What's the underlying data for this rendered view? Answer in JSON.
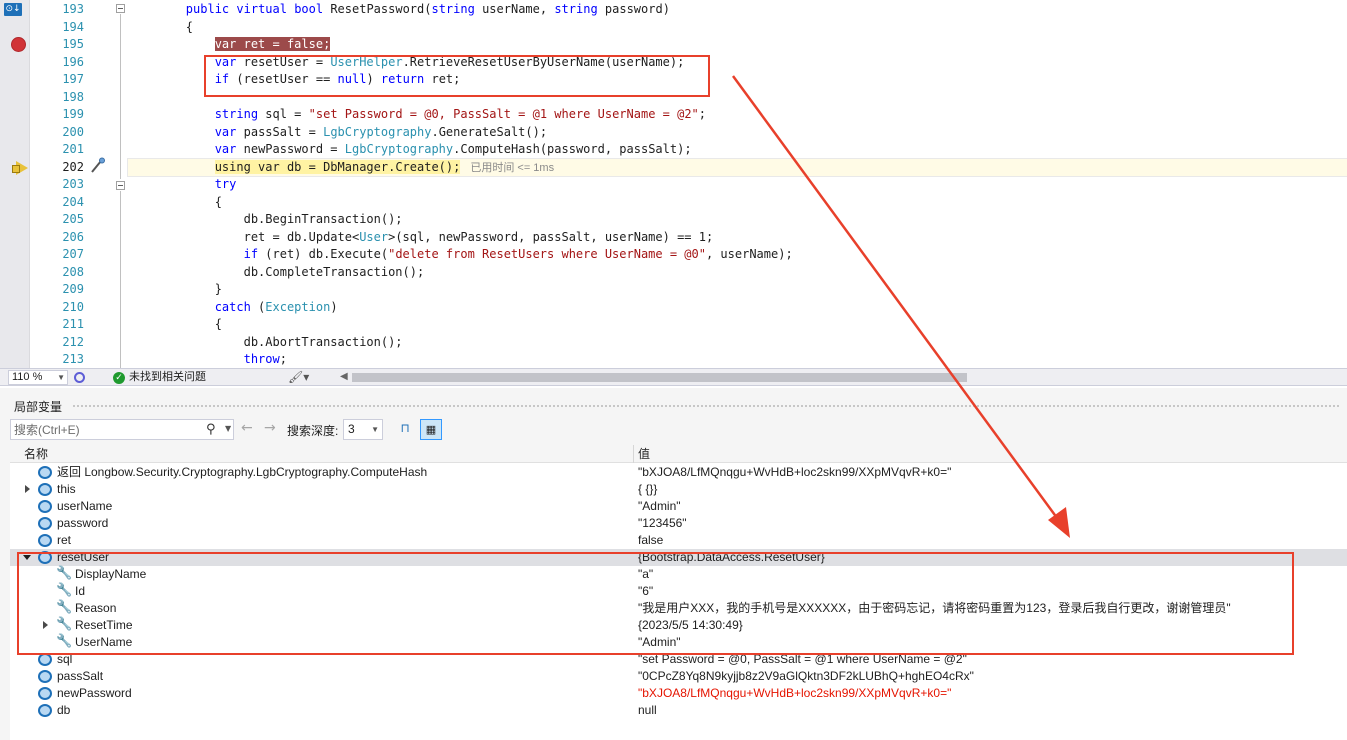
{
  "editor": {
    "line_numbers": [
      "193",
      "194",
      "195",
      "196",
      "197",
      "198",
      "199",
      "200",
      "201",
      "202",
      "203",
      "204",
      "205",
      "206",
      "207",
      "208",
      "209",
      "210",
      "211",
      "212",
      "213"
    ],
    "lines": [
      [
        [
          "pl",
          "        "
        ],
        [
          "kw",
          "public"
        ],
        [
          "pl",
          " "
        ],
        [
          "kw",
          "virtual"
        ],
        [
          "pl",
          " "
        ],
        [
          "kw",
          "bool"
        ],
        [
          "pl",
          " ResetPassword("
        ],
        [
          "kw",
          "string"
        ],
        [
          "pl",
          " userName, "
        ],
        [
          "kw",
          "string"
        ],
        [
          "pl",
          " password)"
        ]
      ],
      [
        [
          "pl",
          "        {"
        ]
      ],
      [
        [
          "pl",
          "            "
        ],
        [
          "bp",
          "var ret = false;"
        ]
      ],
      [
        [
          "pl",
          "            "
        ],
        [
          "kw",
          "var"
        ],
        [
          "pl",
          " resetUser = "
        ],
        [
          "ty",
          "UserHelper"
        ],
        [
          "pl",
          ".RetrieveResetUserByUserName(userName);"
        ]
      ],
      [
        [
          "pl",
          "            "
        ],
        [
          "kw",
          "if"
        ],
        [
          "pl",
          " (resetUser == "
        ],
        [
          "kw",
          "null"
        ],
        [
          "pl",
          ") "
        ],
        [
          "kw",
          "return"
        ],
        [
          "pl",
          " ret;"
        ]
      ],
      [
        [
          "pl",
          ""
        ]
      ],
      [
        [
          "pl",
          "            "
        ],
        [
          "kw",
          "string"
        ],
        [
          "pl",
          " sql = "
        ],
        [
          "str",
          "\"set Password = @0, PassSalt = @1 where UserName = @2\""
        ],
        [
          "pl",
          ";"
        ]
      ],
      [
        [
          "pl",
          "            "
        ],
        [
          "kw",
          "var"
        ],
        [
          "pl",
          " passSalt = "
        ],
        [
          "ty",
          "LgbCryptography"
        ],
        [
          "pl",
          ".GenerateSalt();"
        ]
      ],
      [
        [
          "pl",
          "            "
        ],
        [
          "kw",
          "var"
        ],
        [
          "pl",
          " newPassword = "
        ],
        [
          "ty",
          "LgbCryptography"
        ],
        [
          "pl",
          ".ComputeHash(password, passSalt);"
        ]
      ],
      [
        [
          "pl",
          "            "
        ],
        [
          "nx",
          "using var db = DbManager.Create();"
        ],
        [
          "perf",
          "已用时间 <= 1ms"
        ]
      ],
      [
        [
          "pl",
          "            "
        ],
        [
          "kw",
          "try"
        ]
      ],
      [
        [
          "pl",
          "            {"
        ]
      ],
      [
        [
          "pl",
          "                db.BeginTransaction();"
        ]
      ],
      [
        [
          "pl",
          "                ret = db.Update<"
        ],
        [
          "ty",
          "User"
        ],
        [
          "pl",
          ">(sql, newPassword, passSalt, userName) == 1;"
        ]
      ],
      [
        [
          "pl",
          "                "
        ],
        [
          "kw",
          "if"
        ],
        [
          "pl",
          " (ret) db.Execute("
        ],
        [
          "str",
          "\"delete from ResetUsers where UserName = @0\""
        ],
        [
          "pl",
          ", userName);"
        ]
      ],
      [
        [
          "pl",
          "                db.CompleteTransaction();"
        ]
      ],
      [
        [
          "pl",
          "            }"
        ]
      ],
      [
        [
          "pl",
          "            "
        ],
        [
          "kw",
          "catch"
        ],
        [
          "pl",
          " ("
        ],
        [
          "ty",
          "Exception"
        ],
        [
          "pl",
          ")"
        ]
      ],
      [
        [
          "pl",
          "            {"
        ]
      ],
      [
        [
          "pl",
          "                db.AbortTransaction();"
        ]
      ],
      [
        [
          "pl",
          "                "
        ],
        [
          "kw",
          "throw"
        ],
        [
          "pl",
          ";"
        ]
      ]
    ],
    "breakpoint_line_index": 2,
    "current_line_index": 9
  },
  "status": {
    "zoom": "110 %",
    "issues_text": "未找到相关问题"
  },
  "locals": {
    "title": "局部变量",
    "search_placeholder": "搜索(Ctrl+E)",
    "depth_label": "搜索深度:",
    "depth_value": "3",
    "columns": {
      "name": "名称",
      "value": "值"
    },
    "rows": [
      {
        "name": "返回 Longbow.Security.Cryptography.LgbCryptography.ComputeHash",
        "value": "\"bXJOA8/LfMQnqgu+WvHdB+loc2skn99/XXpMVqvR+k0=\"",
        "icon": "object-icon",
        "indent": 0,
        "expander": "none",
        "changed": false
      },
      {
        "name": "this",
        "value": "{ {}}",
        "icon": "object-icon",
        "indent": 0,
        "expander": "collapsed",
        "changed": false
      },
      {
        "name": "userName",
        "value": "\"Admin\"",
        "icon": "object-icon",
        "indent": 0,
        "expander": "none",
        "changed": false
      },
      {
        "name": "password",
        "value": "\"123456\"",
        "icon": "object-icon",
        "indent": 0,
        "expander": "none",
        "changed": false
      },
      {
        "name": "ret",
        "value": "false",
        "icon": "object-icon",
        "indent": 0,
        "expander": "none",
        "changed": false
      },
      {
        "name": "resetUser",
        "value": "{Bootstrap.DataAccess.ResetUser}",
        "icon": "object-icon",
        "indent": 0,
        "expander": "expanded",
        "changed": false,
        "selected": true
      },
      {
        "name": "DisplayName",
        "value": "\"a\"",
        "icon": "wrench-icon",
        "indent": 1,
        "expander": "none",
        "changed": false
      },
      {
        "name": "Id",
        "value": "\"6\"",
        "icon": "wrench-icon",
        "indent": 1,
        "expander": "none",
        "changed": false
      },
      {
        "name": "Reason",
        "value": "\"我是用户XXX，我的手机号是XXXXXX，由于密码忘记，请将密码重置为123，登录后我自行更改，谢谢管理员\"",
        "icon": "wrench-icon",
        "indent": 1,
        "expander": "none",
        "changed": false
      },
      {
        "name": "ResetTime",
        "value": "{2023/5/5 14:30:49}",
        "icon": "wrench-icon",
        "indent": 1,
        "expander": "collapsed",
        "changed": false
      },
      {
        "name": "UserName",
        "value": "\"Admin\"",
        "icon": "wrench-icon",
        "indent": 1,
        "expander": "none",
        "changed": false
      },
      {
        "name": "sql",
        "value": "\"set Password = @0, PassSalt = @1 where UserName = @2\"",
        "icon": "object-icon",
        "indent": 0,
        "expander": "none",
        "changed": false
      },
      {
        "name": "passSalt",
        "value": "\"0CPcZ8Yq8N9kyjjb8z2V9aGlQktn3DF2kLUBhQ+hghEO4cRx\"",
        "icon": "object-icon",
        "indent": 0,
        "expander": "none",
        "changed": false
      },
      {
        "name": "newPassword",
        "value": "\"bXJOA8/LfMQnqgu+WvHdB+loc2skn99/XXpMVqvR+k0=\"",
        "icon": "object-icon",
        "indent": 0,
        "expander": "none",
        "changed": true
      },
      {
        "name": "db",
        "value": "null",
        "icon": "object-icon",
        "indent": 0,
        "expander": "none",
        "changed": false
      }
    ]
  },
  "colors": {
    "keyword": "#0000ff",
    "type": "#2b91af",
    "string": "#a31515",
    "breakpoint": "#d13438",
    "changed_value": "#e51400",
    "annotation": "#e8402b"
  }
}
